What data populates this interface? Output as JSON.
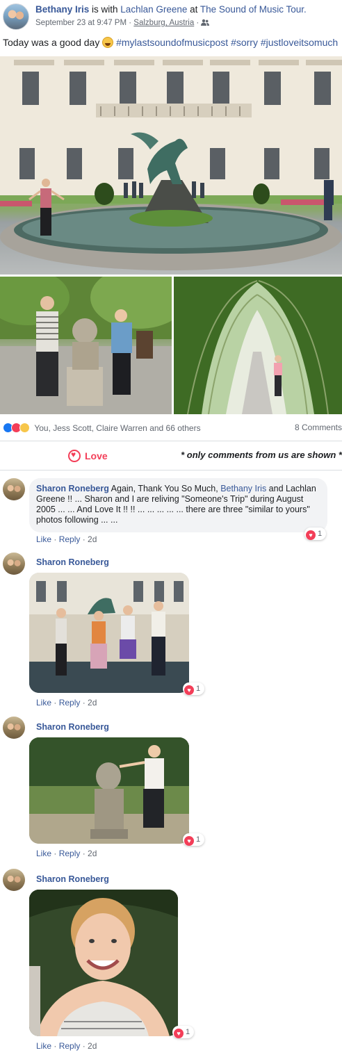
{
  "post": {
    "author": "Bethany Iris",
    "with_text": " is with ",
    "with_person": "Lachlan Greene",
    "at_text": " at ",
    "location_page": "The Sound of Music Tour.",
    "date": "September 23 at 9:47 PM",
    "dot": " · ",
    "place": "Salzburg, Austria",
    "audience_icon": "friends-icon",
    "status_text": "Today was a good day",
    "status_emoji": "grinning-emoji",
    "hashtags": "#mylastsoundofmusicpost #sorry #justloveitsomuch"
  },
  "photos": {
    "main": "mirabell-garden-pegasus-fountain-photo",
    "left": "garden-dwarf-statue-photo",
    "right": "hedge-tunnel-photo"
  },
  "reactions": {
    "icons": [
      "like-icon",
      "love-icon",
      "wow-icon"
    ],
    "summary": "You, Jess Scott, Claire Warren and 66 others",
    "comments_count": "8 Comments"
  },
  "actions": {
    "love_label": "Love",
    "note": "* only comments from us are shown *"
  },
  "comments": [
    {
      "name": "Sharon Roneberg",
      "text_a": " Again, Thank You So Much, ",
      "link": "Bethany Iris",
      "text_b": " and Lachlan Greene !! ... Sharon and I are reliving \"Someone's Trip\" during August 2005 ... ... And Love It !! !! ... ... ... ... ... there are three \"similar to yours\" photos following ... ...",
      "like": "Like",
      "reply": "Reply",
      "time": "2d",
      "reaction_count": "1"
    },
    {
      "name": "Sharon Roneberg",
      "image": "fountain-group-photo-2005",
      "like": "Like",
      "reply": "Reply",
      "time": "2d",
      "reaction_count": "1"
    },
    {
      "name": "Sharon Roneberg",
      "image": "dwarf-statue-photo-2005",
      "like": "Like",
      "reply": "Reply",
      "time": "2d",
      "reaction_count": "1"
    },
    {
      "name": "Sharon Roneberg",
      "image": "smiling-woman-hedge-photo-2005",
      "like": "Like",
      "reply": "Reply",
      "time": "2d",
      "reaction_count": "1"
    }
  ],
  "colors": {
    "link": "#385898",
    "love": "#f33e58",
    "like": "#1877f2",
    "muted": "#616770"
  }
}
